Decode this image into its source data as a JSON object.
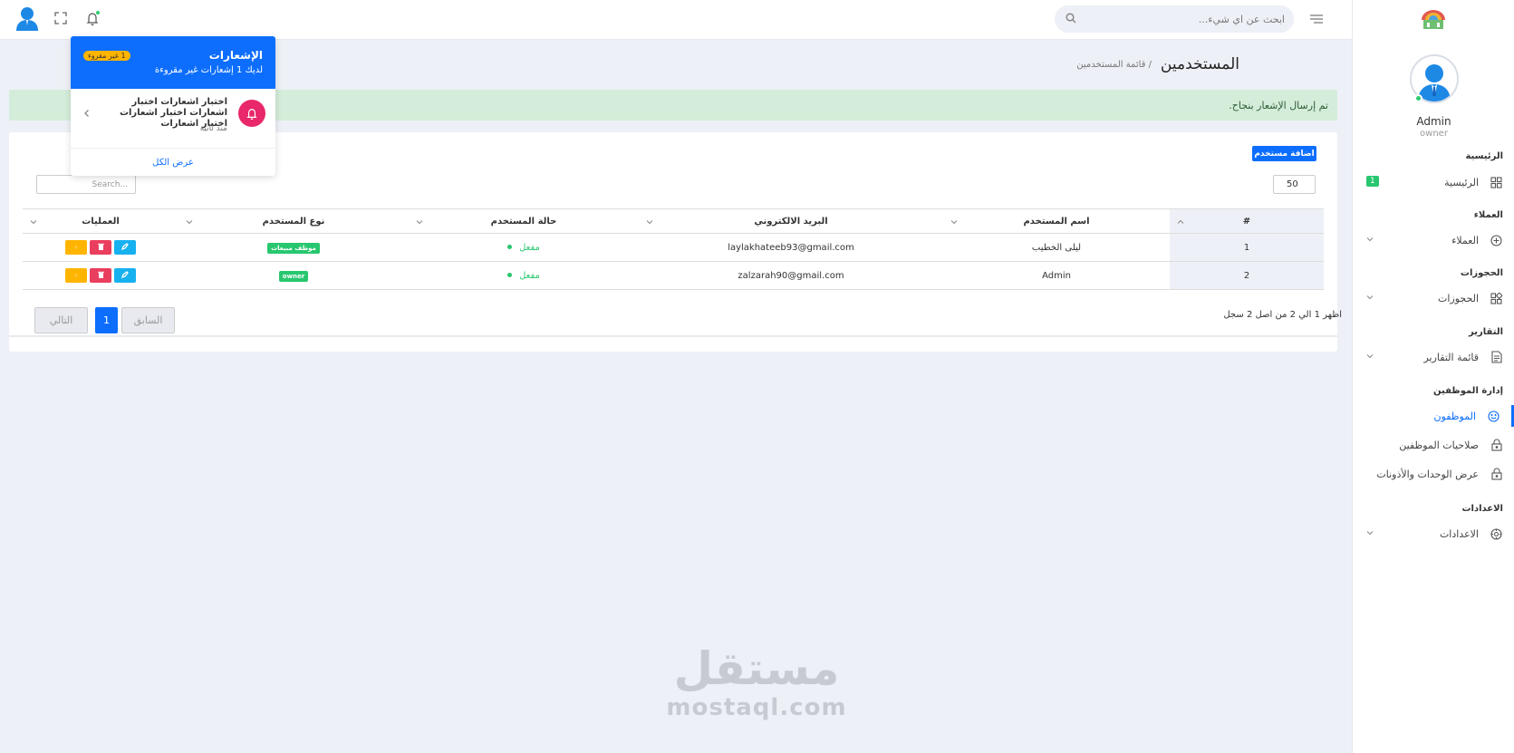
{
  "colors": {
    "primary": "#0d6efd",
    "success": "#28c76f",
    "danger": "#ea3e5e",
    "warning": "#ffb400",
    "info": "#17b1ef",
    "background": "#eef0f7"
  },
  "topbar": {
    "search_placeholder": "ابحث عن اي شيء...",
    "icons": [
      "user-avatar-icon",
      "fullscreen-icon",
      "bell-icon",
      "search-icon",
      "menu-icon"
    ]
  },
  "sidebar": {
    "profile": {
      "name": "Admin",
      "role": "owner"
    },
    "sections": {
      "home": "الرئيسية",
      "clients": "العملاء",
      "bookings": "الحجوزات",
      "reports": "التقارير",
      "staff": "إدارة الموظفين",
      "settings": "الاعدادات"
    },
    "items": {
      "home": {
        "label": "الرئيسية",
        "badge": "1"
      },
      "clients": {
        "label": "العملاء"
      },
      "bookings": {
        "label": "الحجوزات"
      },
      "reports": {
        "label": "قائمة التقارير"
      },
      "employees": {
        "label": "الموظفون"
      },
      "permissions": {
        "label": "صلاحيات الموظفين"
      },
      "units": {
        "label": "عرض الوحدات والأذونات"
      },
      "settings": {
        "label": "الاعدادات"
      }
    }
  },
  "main": {
    "title": "المستخدمين",
    "breadcrumb": "/ قائمة المستخدمين",
    "alert": "تم إرسال الإشعار بنجاح.",
    "add_button": "اضافة مستخدم",
    "page_size": "50",
    "search_placeholder": "Search...",
    "table": {
      "headers": {
        "id": "#",
        "name": "اسم المستخدم",
        "email": "البريد الالكتروني",
        "status": "حالة المستخدم",
        "type": "نوع المستخدم",
        "ops": "العمليات"
      },
      "rows": [
        {
          "id": "1",
          "name": "ليلى الخطيب",
          "email": "laylakhateeb93@gmail.com",
          "status": "مفعل",
          "type": "موظف مبيعات"
        },
        {
          "id": "2",
          "name": "Admin",
          "email": "zalzarah90@gmail.com",
          "status": "مفعل",
          "type": "owner"
        }
      ]
    },
    "info": "اظهر 1 الي 2 من اصل 2 سجل",
    "pagination": {
      "prev": "السابق",
      "current": "1",
      "next": "التالي"
    }
  },
  "notifications": {
    "title": "الإشعارات",
    "subtitle": "لديك 1 إشعارات غير مقروءة",
    "unread_badge": "1 غير مقروء",
    "item_text": "اختبار اشعارات اختبار اشعارات اختبار اشعارات اختبار اشعارات",
    "item_time": "منذ ثانية",
    "view_all": "عرض الكل"
  },
  "watermark": {
    "arabic": "مستقل",
    "latin": "mostaql.com"
  }
}
